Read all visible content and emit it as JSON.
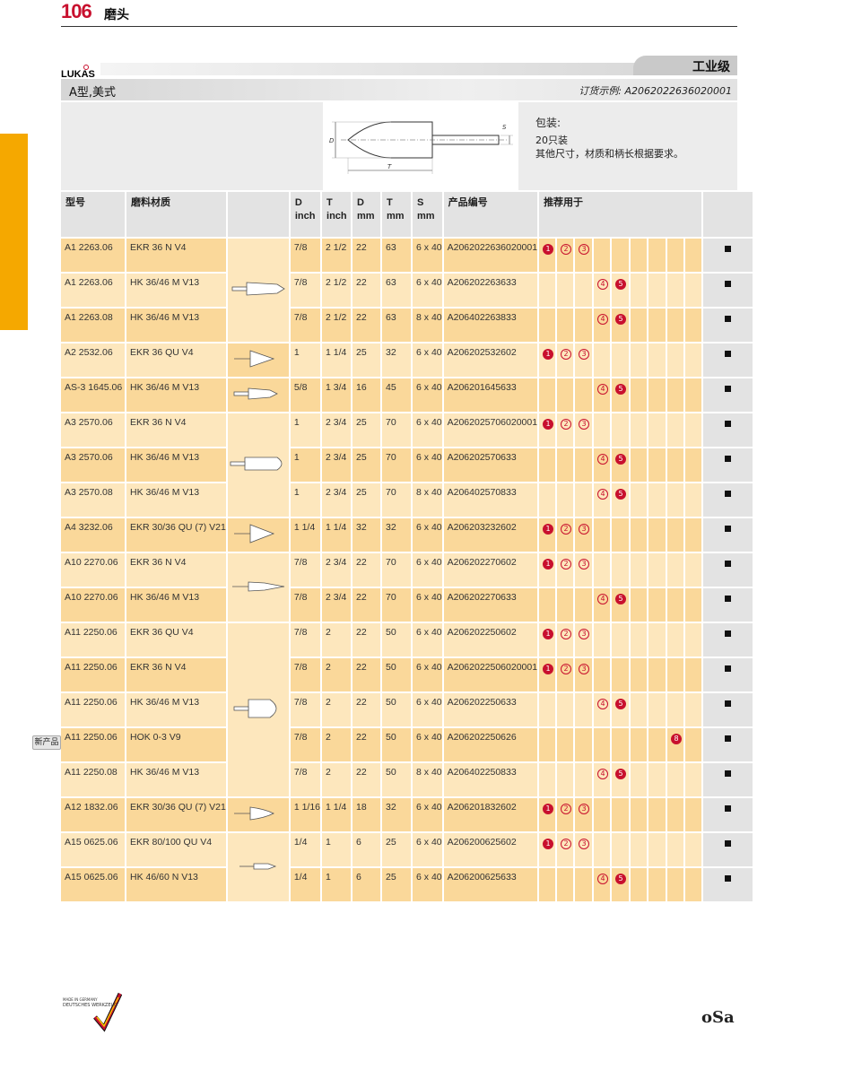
{
  "page": {
    "number": "106",
    "title": "磨头"
  },
  "brand": {
    "logo": "LUKAS",
    "grade": "工业级"
  },
  "section": {
    "title": "A型,美式",
    "order_example": "订货示例: A2062022636020001"
  },
  "packaging": {
    "title": "包装:",
    "qty": "20只装",
    "note": "其他尺寸，材质和柄长根据要求。"
  },
  "drawing": {
    "label_d": "D",
    "label_t": "T",
    "label_s": "S"
  },
  "table": {
    "headers": {
      "type": "型号",
      "material": "磨料材质",
      "d_inch": "D inch",
      "t_inch": "T inch",
      "d_mm": "D mm",
      "t_mm": "T mm",
      "s_mm": "S mm",
      "product_no": "产品编号",
      "recommended": "推荐用于"
    },
    "rows": [
      {
        "type": "A1 2263.06",
        "material": "EKR 36 N V4",
        "d_inch": "7/8",
        "t_inch": "2 1/2",
        "d_mm": "22",
        "t_mm": "63",
        "s": "6 x 40",
        "product_no": "A2062022636020001",
        "rec": [
          "1",
          "2",
          "3"
        ]
      },
      {
        "type": "A1 2263.06",
        "material": "HK 36/46 M V13",
        "d_inch": "7/8",
        "t_inch": "2 1/2",
        "d_mm": "22",
        "t_mm": "63",
        "s": "6 x 40",
        "product_no": "A206202263633",
        "rec": [
          "4",
          "5"
        ]
      },
      {
        "type": "A1 2263.08",
        "material": "HK 36/46 M V13",
        "d_inch": "7/8",
        "t_inch": "2 1/2",
        "d_mm": "22",
        "t_mm": "63",
        "s": "8 x 40",
        "product_no": "A206402263833",
        "rec": [
          "4",
          "5"
        ]
      },
      {
        "type": "A2 2532.06",
        "material": "EKR 36 QU V4",
        "d_inch": "1",
        "t_inch": "1 1/4",
        "d_mm": "25",
        "t_mm": "32",
        "s": "6 x 40",
        "product_no": "A206202532602",
        "rec": [
          "1",
          "2",
          "3"
        ]
      },
      {
        "type": "AS-3 1645.06",
        "material": "HK 36/46 M V13",
        "d_inch": "5/8",
        "t_inch": "1 3/4",
        "d_mm": "16",
        "t_mm": "45",
        "s": "6 x 40",
        "product_no": "A206201645633",
        "rec": [
          "4",
          "5"
        ]
      },
      {
        "type": "A3 2570.06",
        "material": "EKR 36 N V4",
        "d_inch": "1",
        "t_inch": "2 3/4",
        "d_mm": "25",
        "t_mm": "70",
        "s": "6 x 40",
        "product_no": "A2062025706020001",
        "rec": [
          "1",
          "2",
          "3"
        ]
      },
      {
        "type": "A3 2570.06",
        "material": "HK 36/46 M V13",
        "d_inch": "1",
        "t_inch": "2 3/4",
        "d_mm": "25",
        "t_mm": "70",
        "s": "6 x 40",
        "product_no": "A206202570633",
        "rec": [
          "4",
          "5"
        ]
      },
      {
        "type": "A3 2570.08",
        "material": "HK 36/46 M V13",
        "d_inch": "1",
        "t_inch": "2 3/4",
        "d_mm": "25",
        "t_mm": "70",
        "s": "8 x 40",
        "product_no": "A206402570833",
        "rec": [
          "4",
          "5"
        ]
      },
      {
        "type": "A4 3232.06",
        "material": "EKR 30/36 QU (7) V21",
        "d_inch": "1 1/4",
        "t_inch": "1 1/4",
        "d_mm": "32",
        "t_mm": "32",
        "s": "6 x 40",
        "product_no": "A206203232602",
        "rec": [
          "1",
          "2",
          "3"
        ]
      },
      {
        "type": "A10 2270.06",
        "material": "EKR 36 N V4",
        "d_inch": "7/8",
        "t_inch": "2 3/4",
        "d_mm": "22",
        "t_mm": "70",
        "s": "6 x 40",
        "product_no": "A206202270602",
        "rec": [
          "1",
          "2",
          "3"
        ]
      },
      {
        "type": "A10 2270.06",
        "material": "HK 36/46 M V13",
        "d_inch": "7/8",
        "t_inch": "2 3/4",
        "d_mm": "22",
        "t_mm": "70",
        "s": "6 x 40",
        "product_no": "A206202270633",
        "rec": [
          "4",
          "5"
        ]
      },
      {
        "type": "A11 2250.06",
        "material": "EKR 36 QU V4",
        "d_inch": "7/8",
        "t_inch": "2",
        "d_mm": "22",
        "t_mm": "50",
        "s": "6 x 40",
        "product_no": "A206202250602",
        "rec": [
          "1",
          "2",
          "3"
        ]
      },
      {
        "type": "A11 2250.06",
        "material": "EKR 36 N V4",
        "d_inch": "7/8",
        "t_inch": "2",
        "d_mm": "22",
        "t_mm": "50",
        "s": "6 x 40",
        "product_no": "A2062022506020001",
        "rec": [
          "1",
          "2",
          "3"
        ]
      },
      {
        "type": "A11 2250.06",
        "material": "HK 36/46 M V13",
        "d_inch": "7/8",
        "t_inch": "2",
        "d_mm": "22",
        "t_mm": "50",
        "s": "6 x 40",
        "product_no": "A206202250633",
        "rec": [
          "4",
          "5"
        ]
      },
      {
        "type": "A11 2250.06",
        "material": "HOK 0-3 V9",
        "d_inch": "7/8",
        "t_inch": "2",
        "d_mm": "22",
        "t_mm": "50",
        "s": "6 x 40",
        "product_no": "A206202250626",
        "rec": [
          "8"
        ],
        "new": "新产品"
      },
      {
        "type": "A11 2250.08",
        "material": "HK 36/46 M V13",
        "d_inch": "7/8",
        "t_inch": "2",
        "d_mm": "22",
        "t_mm": "50",
        "s": "8 x 40",
        "product_no": "A206402250833",
        "rec": [
          "4",
          "5"
        ]
      },
      {
        "type": "A12 1832.06",
        "material": "EKR 30/36 QU (7) V21",
        "d_inch": "1 1/16",
        "t_inch": "1 1/4",
        "d_mm": "18",
        "t_mm": "32",
        "s": "6 x 40",
        "product_no": "A206201832602",
        "rec": [
          "1",
          "2",
          "3"
        ]
      },
      {
        "type": "A15 0625.06",
        "material": "EKR 80/100 QU V4",
        "d_inch": "1/4",
        "t_inch": "1",
        "d_mm": "6",
        "t_mm": "25",
        "s": "6 x 40",
        "product_no": "A206200625602",
        "rec": [
          "1",
          "2",
          "3"
        ]
      },
      {
        "type": "A15 0625.06",
        "material": "HK 46/60 N V13",
        "d_inch": "1/4",
        "t_inch": "1",
        "d_mm": "6",
        "t_mm": "25",
        "s": "6 x 40",
        "product_no": "A206200625633",
        "rec": [
          "4",
          "5"
        ]
      }
    ]
  },
  "footer": {
    "made_in": "MADE IN GERMANY",
    "made_brand": "DEUTSCHES WERKZEUG",
    "osa": "oSa"
  },
  "colors": {
    "accent_red": "#c8102e",
    "orange_tab": "#f5a800",
    "row_dark": "#fad89a",
    "row_light": "#fde7bd"
  }
}
